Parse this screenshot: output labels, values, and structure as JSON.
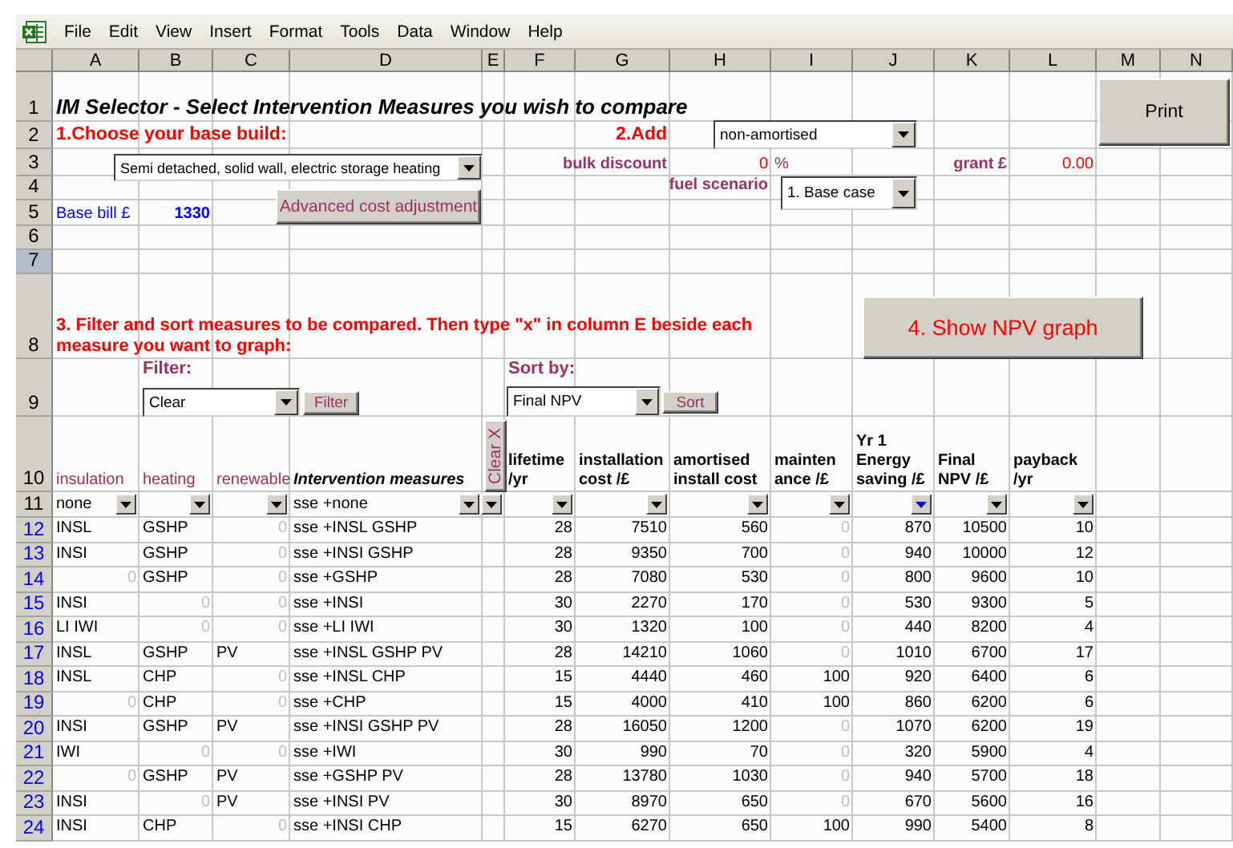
{
  "menu": [
    "File",
    "Edit",
    "View",
    "Insert",
    "Format",
    "Tools",
    "Data",
    "Window",
    "Help"
  ],
  "columns": [
    "A",
    "B",
    "C",
    "D",
    "E",
    "F",
    "G",
    "H",
    "I",
    "J",
    "K",
    "L",
    "M",
    "N"
  ],
  "row_headers": [
    {
      "label": "1",
      "selected": false,
      "kind": "plain"
    },
    {
      "label": "2",
      "selected": false,
      "kind": "plain"
    },
    {
      "label": "3",
      "selected": false,
      "kind": "plain"
    },
    {
      "label": "4",
      "selected": false,
      "kind": "plain"
    },
    {
      "label": "5",
      "selected": false,
      "kind": "plain"
    },
    {
      "label": "6",
      "selected": false,
      "kind": "plain"
    },
    {
      "label": "7",
      "selected": true,
      "kind": "plain"
    },
    {
      "label": "8",
      "selected": false,
      "kind": "plain"
    },
    {
      "label": "9",
      "selected": false,
      "kind": "plain"
    },
    {
      "label": "10",
      "selected": false,
      "kind": "plain"
    },
    {
      "label": "11",
      "selected": false,
      "kind": "plain"
    },
    {
      "label": "12",
      "selected": false,
      "kind": "linked"
    },
    {
      "label": "13",
      "selected": false,
      "kind": "linked"
    },
    {
      "label": "14",
      "selected": false,
      "kind": "linked"
    },
    {
      "label": "15",
      "selected": false,
      "kind": "linked"
    },
    {
      "label": "16",
      "selected": false,
      "kind": "linked"
    },
    {
      "label": "17",
      "selected": false,
      "kind": "linked"
    },
    {
      "label": "18",
      "selected": false,
      "kind": "linked"
    },
    {
      "label": "19",
      "selected": false,
      "kind": "linked"
    },
    {
      "label": "20",
      "selected": false,
      "kind": "linked"
    },
    {
      "label": "21",
      "selected": false,
      "kind": "linked"
    },
    {
      "label": "22",
      "selected": false,
      "kind": "linked"
    },
    {
      "label": "23",
      "selected": false,
      "kind": "linked"
    },
    {
      "label": "24",
      "selected": false,
      "kind": "linked"
    }
  ],
  "title": "IM Selector - Select Intervention Measures you wish to compare",
  "step1": "1.Choose your base build:",
  "base_build": {
    "value": "Semi detached, solid wall, electric storage heating"
  },
  "base_bill": {
    "label": "Base bill £",
    "value": "1330"
  },
  "advanced_button": "Advanced cost adjustment",
  "step2": {
    "label": "2.Add",
    "value": "non-amortised"
  },
  "bulk_discount": {
    "label": "bulk discount",
    "value": "0",
    "unit": "%"
  },
  "grant": {
    "label": "grant £",
    "value": "0.00"
  },
  "fuel_scenario": {
    "label": "fuel scenario",
    "value": "1. Base case"
  },
  "print_button": "Print",
  "step3": "3. Filter and sort measures to be compared. Then type \"x\" in column E beside each measure you want to graph:",
  "npv_button": "4. Show NPV graph",
  "filter": {
    "label": "Filter:",
    "value": "Clear",
    "button": "Filter"
  },
  "sort": {
    "label": "Sort by:",
    "value": "Final NPV",
    "button": "Sort"
  },
  "table": {
    "headers": [
      {
        "label": "insulation",
        "kind": "category"
      },
      {
        "label": "heating",
        "kind": "category"
      },
      {
        "label": "renewable",
        "kind": "category"
      },
      {
        "label": "Intervention measures",
        "kind": "measure"
      },
      {
        "label": "lifetime\n/yr",
        "kind": "metric"
      },
      {
        "label": "installation\ncost /£",
        "kind": "metric"
      },
      {
        "label": "amortised\ninstall cost",
        "kind": "metric"
      },
      {
        "label": "mainten\nance /£",
        "kind": "metric"
      },
      {
        "label": "Yr 1\nEnergy\nsaving /£",
        "kind": "metric"
      },
      {
        "label": "Final\nNPV /£",
        "kind": "metric"
      },
      {
        "label": "payback\n/yr",
        "kind": "metric"
      }
    ],
    "clear_button": "Clear X",
    "filters": [
      {
        "value": "none",
        "active": false
      },
      {
        "active": false
      },
      {
        "active": false
      },
      {
        "value": "sse +none",
        "active": false
      },
      {
        "active": false
      },
      {
        "active": false
      },
      {
        "active": false
      },
      {
        "active": false
      },
      {
        "active": false
      },
      {
        "active": true
      },
      {
        "active": false
      },
      {
        "active": false
      }
    ],
    "rows": [
      {
        "cells": [
          "INSL",
          "GSHP",
          {
            "text": "0",
            "muted": true
          },
          "sse +INSL GSHP",
          "28",
          "7510",
          "560",
          {
            "text": "0",
            "muted": true
          },
          "870",
          "10500",
          "10"
        ]
      },
      {
        "cells": [
          "INSI",
          "GSHP",
          {
            "text": "0",
            "muted": true
          },
          "sse +INSI GSHP",
          "28",
          "9350",
          "700",
          {
            "text": "0",
            "muted": true
          },
          "940",
          "10000",
          "12"
        ]
      },
      {
        "cells": [
          {
            "text": "0",
            "muted": true
          },
          "GSHP",
          {
            "text": "0",
            "muted": true
          },
          "sse +GSHP",
          "28",
          "7080",
          "530",
          {
            "text": "0",
            "muted": true
          },
          "800",
          "9600",
          "10"
        ]
      },
      {
        "cells": [
          "INSI",
          {
            "text": "0",
            "muted": true
          },
          {
            "text": "0",
            "muted": true
          },
          "sse +INSI",
          "30",
          "2270",
          "170",
          {
            "text": "0",
            "muted": true
          },
          "530",
          "9300",
          "5"
        ]
      },
      {
        "cells": [
          "LI IWI",
          {
            "text": "0",
            "muted": true
          },
          {
            "text": "0",
            "muted": true
          },
          "sse +LI IWI",
          "30",
          "1320",
          "100",
          {
            "text": "0",
            "muted": true
          },
          "440",
          "8200",
          "4"
        ]
      },
      {
        "cells": [
          "INSL",
          "GSHP",
          "PV",
          "sse +INSL GSHP PV",
          "28",
          "14210",
          "1060",
          {
            "text": "0",
            "muted": true
          },
          "1010",
          "6700",
          "17"
        ]
      },
      {
        "cells": [
          "INSL",
          "CHP",
          {
            "text": "0",
            "muted": true
          },
          "sse +INSL CHP",
          "15",
          "4440",
          "460",
          "100",
          "920",
          "6400",
          "6"
        ]
      },
      {
        "cells": [
          {
            "text": "0",
            "muted": true
          },
          "CHP",
          {
            "text": "0",
            "muted": true
          },
          "sse +CHP",
          "15",
          "4000",
          "410",
          "100",
          "860",
          "6200",
          "6"
        ]
      },
      {
        "cells": [
          "INSI",
          "GSHP",
          "PV",
          "sse +INSI GSHP PV",
          "28",
          "16050",
          "1200",
          {
            "text": "0",
            "muted": true
          },
          "1070",
          "6200",
          "19"
        ]
      },
      {
        "cells": [
          "IWI",
          {
            "text": "0",
            "muted": true
          },
          {
            "text": "0",
            "muted": true
          },
          "sse +IWI",
          "30",
          "990",
          "70",
          {
            "text": "0",
            "muted": true
          },
          "320",
          "5900",
          "4"
        ]
      },
      {
        "cells": [
          {
            "text": "0",
            "muted": true
          },
          "GSHP",
          "PV",
          "sse +GSHP PV",
          "28",
          "13780",
          "1030",
          {
            "text": "0",
            "muted": true
          },
          "940",
          "5700",
          "18"
        ]
      },
      {
        "cells": [
          "INSI",
          {
            "text": "0",
            "muted": true
          },
          "PV",
          "sse +INSI PV",
          "30",
          "8970",
          "650",
          {
            "text": "0",
            "muted": true
          },
          "670",
          "5600",
          "16"
        ]
      },
      {
        "cells": [
          "INSI",
          "CHP",
          {
            "text": "0",
            "muted": true
          },
          "sse +INSI CHP",
          "15",
          "6270",
          "650",
          "100",
          "990",
          "5400",
          "8"
        ]
      }
    ]
  }
}
